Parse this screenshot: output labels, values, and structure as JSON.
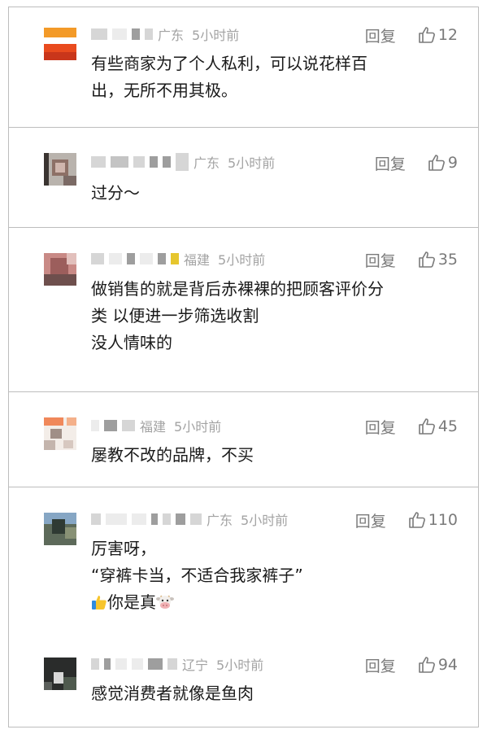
{
  "comments": [
    {
      "location": "广东",
      "time": "5小时前",
      "reply_label": "回复",
      "likes": "12",
      "lines": [
        "有些商家为了个人私利，可以说花样百",
        "出，无所不用其极。"
      ]
    },
    {
      "location": "广东",
      "time": "5小时前",
      "reply_label": "回复",
      "likes": "9",
      "lines": [
        "过分～"
      ]
    },
    {
      "location": "福建",
      "time": "5小时前",
      "reply_label": "回复",
      "likes": "35",
      "lines": [
        "做销售的就是背后赤裸裸的把顾客评价分",
        "类 以便进一步筛选收割",
        "没人情味的"
      ]
    },
    {
      "location": "福建",
      "time": "5小时前",
      "reply_label": "回复",
      "likes": "45",
      "lines": [
        "屡教不改的品牌，不买"
      ]
    },
    {
      "location": "广东",
      "time": "5小时前",
      "reply_label": "回复",
      "likes": "110",
      "lines": [
        "厉害呀，",
        "“穿裤卡当，不适合我家裤子”",
        "你是真"
      ]
    },
    {
      "location": "辽宁",
      "time": "5小时前",
      "reply_label": "回复",
      "likes": "94",
      "lines": [
        "感觉消费者就像是鱼肉"
      ]
    }
  ],
  "icons": {
    "like": "thumbs-up-outline-icon",
    "emoji_thumb": "thumbs-up-emoji-icon",
    "emoji_cow": "cow-face-emoji-icon"
  },
  "colors": {
    "meta_gray": "#a3a3a3",
    "action_gray": "#7a7a7a",
    "text": "#1a1a1a",
    "divider": "#bdbdbd"
  }
}
